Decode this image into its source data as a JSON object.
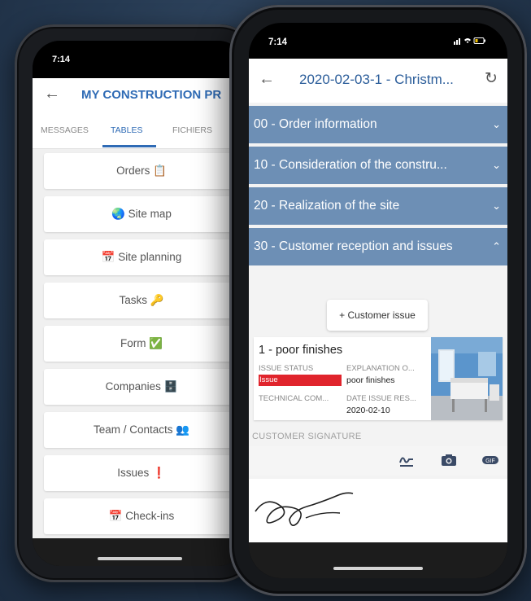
{
  "back_phone": {
    "status_time": "7:14",
    "header": {
      "title": "MY CONSTRUCTION PR"
    },
    "tabs": [
      {
        "label": "MESSAGES"
      },
      {
        "label": "TABLES",
        "active": true
      },
      {
        "label": "FICHIERS"
      }
    ],
    "menu_items": [
      {
        "label": "Orders 📋"
      },
      {
        "label": "🌏 Site map"
      },
      {
        "label": "📅 Site planning"
      },
      {
        "label": "Tasks 🔑"
      },
      {
        "label": "Form ✅"
      },
      {
        "label": "Companies 🗄️"
      },
      {
        "label": "Team / Contacts 👥"
      },
      {
        "label": "Issues ❗"
      },
      {
        "label": "📅 Check-ins"
      }
    ]
  },
  "front_phone": {
    "status_time": "7:14",
    "header": {
      "title": "2020-02-03-1 - Christm..."
    },
    "sections": [
      {
        "label": "00 - Order information",
        "expanded": false
      },
      {
        "label": "10 - Consideration of the constru...",
        "expanded": false
      },
      {
        "label": "20 - Realization of the site",
        "expanded": false
      },
      {
        "label": "30 - Customer reception and issues",
        "expanded": true
      }
    ],
    "customer_issue_button": "+ Customer issue",
    "issue": {
      "title": "1 - poor finishes",
      "status_label": "ISSUE STATUS",
      "status_value": "Issue",
      "explanation_label": "EXPLANATION O...",
      "explanation_value": "poor finishes",
      "technical_label": "TECHNICAL COM...",
      "date_label": "DATE ISSUE RES...",
      "date_value": "2020-02-10"
    },
    "signature_label": "CUSTOMER SIGNATURE",
    "colors": {
      "section_bg": "#6d8fb5",
      "accent": "#2b5d9a",
      "badge": "#e0242c"
    }
  }
}
